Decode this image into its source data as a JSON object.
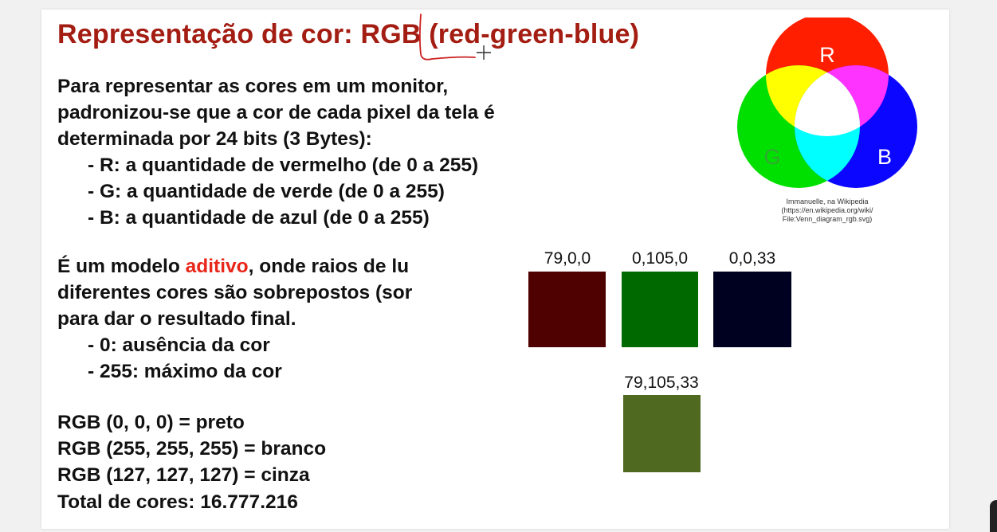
{
  "slide": {
    "title_prefix": "Representação de cor: ",
    "title_rgb": "RGB",
    "title_suffix": " (red-green-blue)",
    "para1": {
      "lines": [
        "Para representar as cores em um monitor,",
        "padronizou-se que a cor de cada pixel da tela é",
        "determinada por 24 bits (3 Bytes):"
      ],
      "bullets": [
        "- R: a quantidade de vermelho (de 0 a 255)",
        "- G: a quantidade de verde (de 0 a 255)",
        "- B: a quantidade de azul (de 0 a 255)"
      ]
    },
    "para2": {
      "line1_before": "É um modelo ",
      "line1_accent": "aditivo",
      "line1_after": ", onde raios de lu",
      "line2": "diferentes cores são sobrepostos (sor",
      "line3": "para dar o resultado final.",
      "bullets": [
        "- 0: ausência da cor",
        "- 255: máximo da cor"
      ]
    },
    "rgb_examples": [
      "RGB (0, 0, 0) = preto",
      "RGB (255, 255, 255) = branco",
      "RGB (127, 127, 127) = cinza"
    ],
    "total": "Total de cores: 16.777.216",
    "venn": {
      "labels": {
        "r": "R",
        "g": "G",
        "b": "B"
      },
      "credit": [
        "Immanuelle, na Wikipedia",
        "(https://en.wikipedia.org/wiki/",
        "File:Venn_diagram_rgb.svg)"
      ]
    },
    "swatches": [
      {
        "label": "79,0,0",
        "color": "#4f0000"
      },
      {
        "label": "0,105,0",
        "color": "#006900"
      },
      {
        "label": "0,0,33",
        "color": "#000021"
      },
      {
        "label": "79,105,33",
        "color": "#4f6921"
      }
    ]
  },
  "colors": {
    "title": "#a31d12",
    "accent": "#e8261a",
    "annotation_pen": "#cc1f1f"
  }
}
